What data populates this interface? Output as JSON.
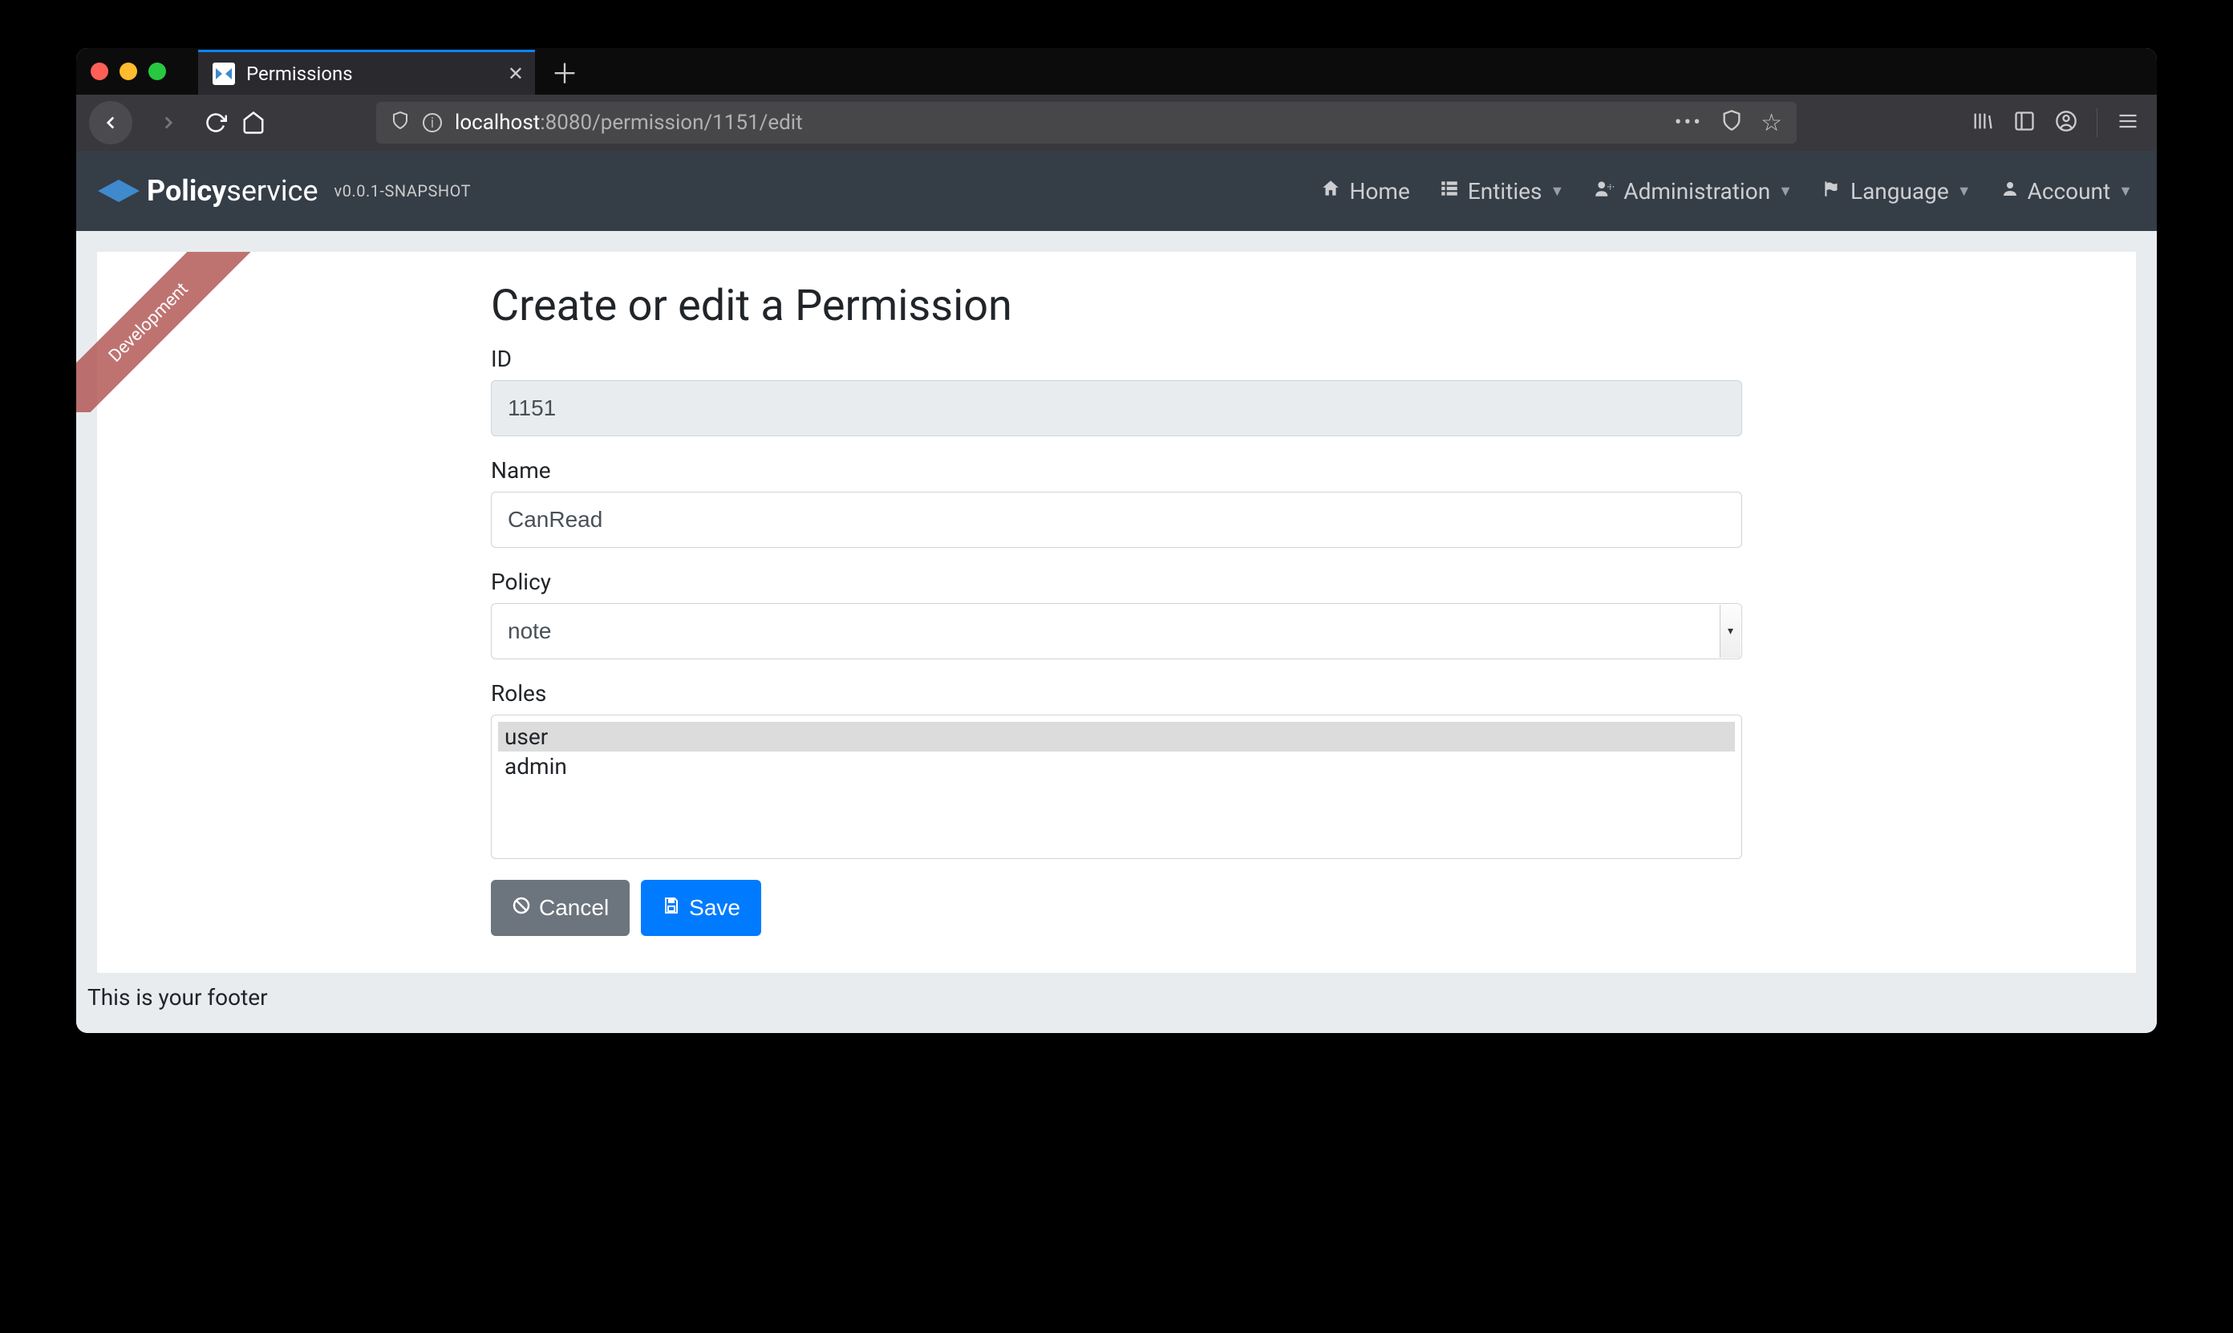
{
  "browser": {
    "tab_title": "Permissions",
    "url_host": "localhost",
    "url_port": ":8080",
    "url_path": "/permission/1151/edit"
  },
  "ribbon": "Development",
  "brand": {
    "name_bold": "Policy",
    "name_light": "service",
    "version": "v0.0.1-SNAPSHOT"
  },
  "nav": {
    "home": "Home",
    "entities": "Entities",
    "administration": "Administration",
    "language": "Language",
    "account": "Account"
  },
  "page": {
    "title": "Create or edit a Permission",
    "labels": {
      "id": "ID",
      "name": "Name",
      "policy": "Policy",
      "roles": "Roles"
    },
    "values": {
      "id": "1151",
      "name": "CanRead",
      "policy": "note",
      "roles": [
        "user",
        "admin"
      ],
      "roles_selected": "user"
    },
    "buttons": {
      "cancel": "Cancel",
      "save": "Save"
    }
  },
  "footer": "This is your footer"
}
